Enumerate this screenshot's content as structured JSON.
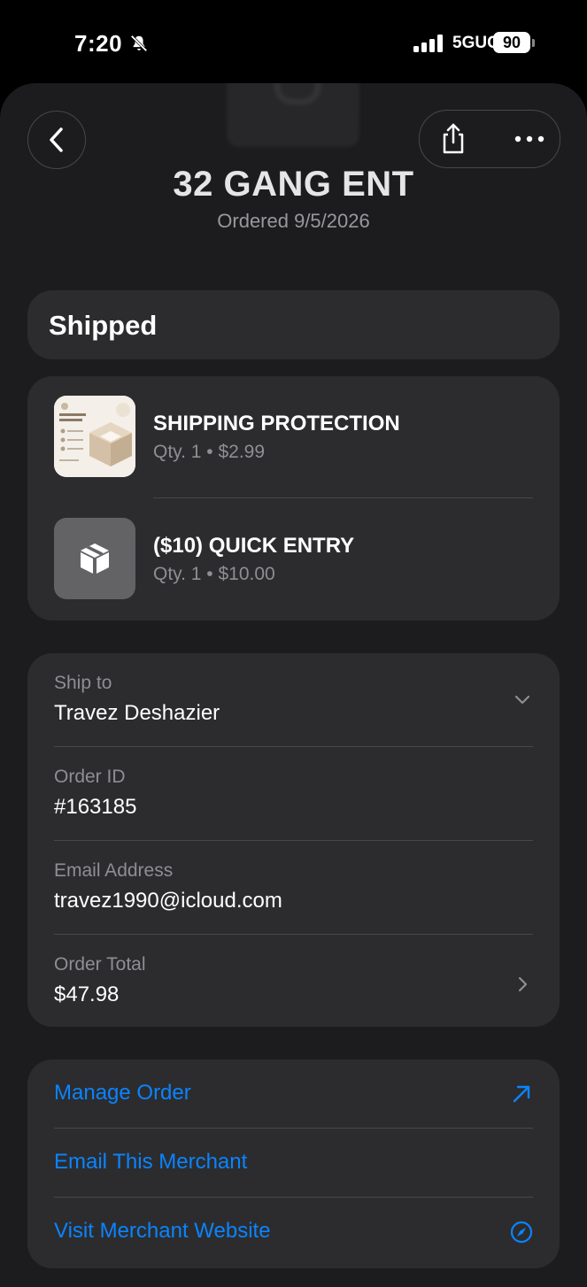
{
  "status_bar": {
    "time": "7:20",
    "network": "5GUC",
    "battery": "90",
    "icons": [
      "bell-slash-icon",
      "signal-icon"
    ]
  },
  "header": {
    "merchant_name": "32 GANG ENT",
    "ordered_date": "Ordered 9/5/2026",
    "icons": [
      "chevron-left-icon",
      "share-icon",
      "ellipsis-icon"
    ]
  },
  "order_status": "Shipped",
  "items": [
    {
      "name": "SHIPPING PROTECTION",
      "qty_price": "Qty. 1 • $2.99",
      "thumb": "shipping-protection-photo"
    },
    {
      "name": "($10) QUICK ENTRY",
      "qty_price": "Qty. 1 • $10.00",
      "thumb": "package-icon"
    }
  ],
  "details": {
    "ship_to_label": "Ship to",
    "ship_to_value": "Travez Deshazier",
    "order_id_label": "Order ID",
    "order_id_value": "#163185",
    "email_label": "Email Address",
    "email_value": "travez1990@icloud.com",
    "total_label": "Order Total",
    "total_value": "$47.98"
  },
  "links": {
    "manage_order": "Manage Order",
    "email_merchant": "Email This Merchant",
    "visit_website": "Visit Merchant Website"
  },
  "colors": {
    "background": "#000000",
    "card": "#2c2c2e",
    "sheet": "#1c1c1e",
    "link": "#0a84ff",
    "secondary_text": "#8e8e93"
  }
}
